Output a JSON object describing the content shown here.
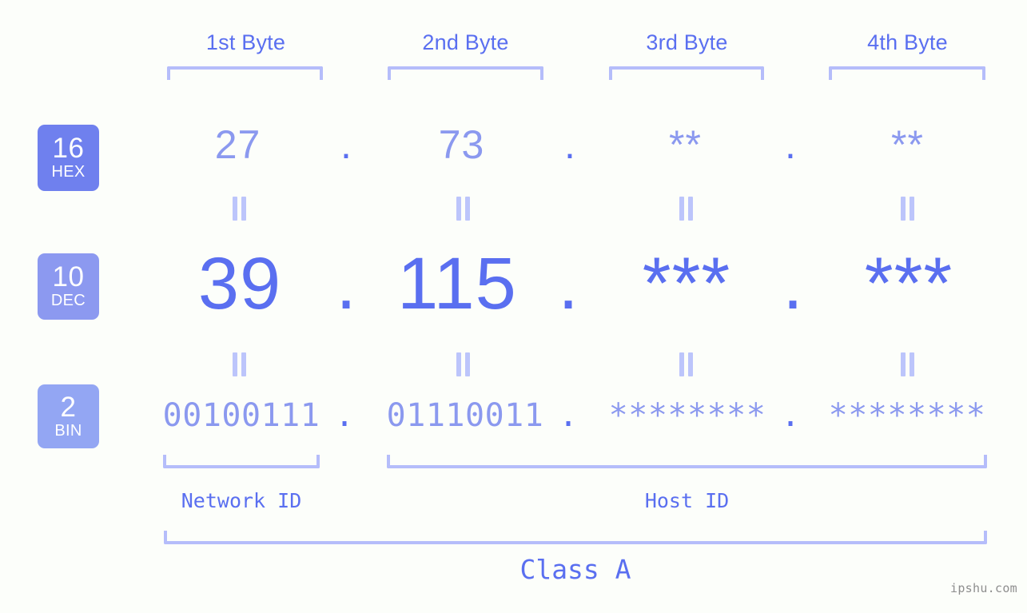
{
  "page": {
    "background_color": "#fcfefa",
    "accent_color": "#5a6ff0",
    "light_accent_color": "#8b99ef",
    "bracket_color": "#b5bdfa",
    "watermark": "ipshu.com"
  },
  "byte_headers": [
    {
      "label": "1st Byte"
    },
    {
      "label": "2nd Byte"
    },
    {
      "label": "3rd Byte"
    },
    {
      "label": "4th Byte"
    }
  ],
  "bases": [
    {
      "number": "16",
      "name": "HEX",
      "color": "#6f80ee"
    },
    {
      "number": "10",
      "name": "DEC",
      "color": "#8c99f0"
    },
    {
      "number": "2",
      "name": "BIN",
      "color": "#93a6f3"
    }
  ],
  "separator": ".",
  "rows": {
    "hex": {
      "base_number": "16",
      "base_name": "HEX",
      "values": [
        "27",
        "73",
        "**",
        "**"
      ]
    },
    "dec": {
      "base_number": "10",
      "base_name": "DEC",
      "values": [
        "39",
        "115",
        "***",
        "***"
      ]
    },
    "bin": {
      "base_number": "2",
      "base_name": "BIN",
      "values": [
        "00100111",
        "01110011",
        "********",
        "********"
      ]
    }
  },
  "equals_symbol": "=",
  "segments": [
    {
      "label": "Network ID"
    },
    {
      "label": "Host ID"
    }
  ],
  "class": {
    "label": "Class A"
  }
}
